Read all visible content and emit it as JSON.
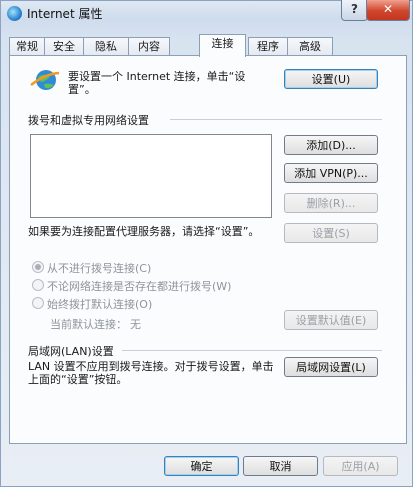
{
  "window": {
    "title": "Internet 属性"
  },
  "tabs": [
    "常规",
    "安全",
    "隐私",
    "内容",
    "连接",
    "程序",
    "高级"
  ],
  "connection": {
    "setup_text": "要设置一个 Internet 连接，单击“设置”。",
    "setup_button": "设置(U)"
  },
  "dialup": {
    "heading": "拨号和虚拟专用网络设置",
    "add_button": "添加(D)...",
    "add_vpn_button": "添加 VPN(P)...",
    "remove_button": "删除(R)...",
    "proxy_text": "如果要为连接配置代理服务器，请选择“设置”。",
    "settings_button": "设置(S)",
    "options": [
      "从不进行拨号连接(C)",
      "不论网络连接是否存在都进行拨号(W)",
      "始终拨打默认连接(O)"
    ],
    "current_default_label": "当前默认连接：",
    "current_default_value": "无",
    "set_default_button": "设置默认值(E)"
  },
  "lan": {
    "heading": "局域网(LAN)设置",
    "description": "LAN 设置不应用到拨号连接。对于拨号设置，单击上面的“设置”按钮。",
    "button": "局域网设置(L)"
  },
  "footer": {
    "ok": "确定",
    "cancel": "取消",
    "apply": "应用(A)"
  },
  "colors": {
    "accent": "#3c7fb1",
    "close": "#c23620"
  },
  "icons": {
    "title": "internet-globe-icon",
    "connection": "globe-connection-icon"
  }
}
